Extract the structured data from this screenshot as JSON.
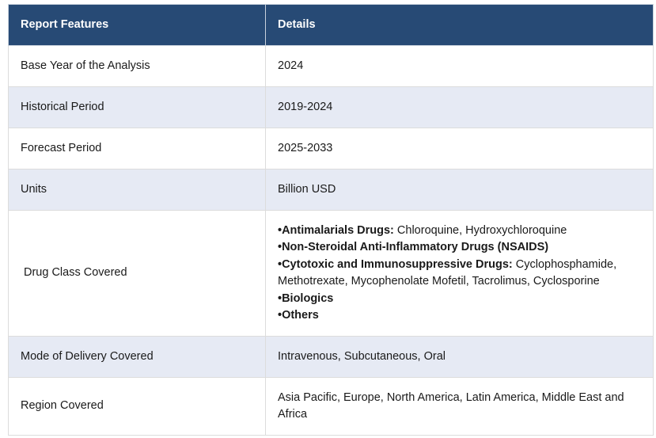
{
  "table": {
    "headers": [
      "Report Features",
      "Details"
    ],
    "rows": [
      {
        "feature": "Base Year of the Analysis",
        "detail": "2024"
      },
      {
        "feature": "Historical Period",
        "detail": "2019-2024"
      },
      {
        "feature": "Forecast Period",
        "detail": "2025-2033"
      },
      {
        "feature": "Units",
        "detail": "Billion USD"
      },
      {
        "feature": "Drug Class Covered",
        "bullets": [
          {
            "bold": "•Antimalarials Drugs:",
            "text": " Chloroquine, Hydroxychloroquine"
          },
          {
            "bold": "•Non-Steroidal Anti-Inflammatory Drugs (NSAIDS)",
            "text": ""
          },
          {
            "bold": "•Cytotoxic and Immunosuppressive Drugs:",
            "text": " Cyclophosphamide, Methotrexate, Mycophenolate Mofetil, Tacrolimus, Cyclosporine"
          },
          {
            "bold": "•Biologics",
            "text": ""
          },
          {
            "bold": "•Others",
            "text": ""
          }
        ]
      },
      {
        "feature": "Mode of Delivery Covered",
        "detail": "Intravenous, Subcutaneous, Oral"
      },
      {
        "feature": "Region Covered",
        "detail": " Asia Pacific, Europe, North America, Latin America, Middle East and Africa"
      }
    ]
  }
}
